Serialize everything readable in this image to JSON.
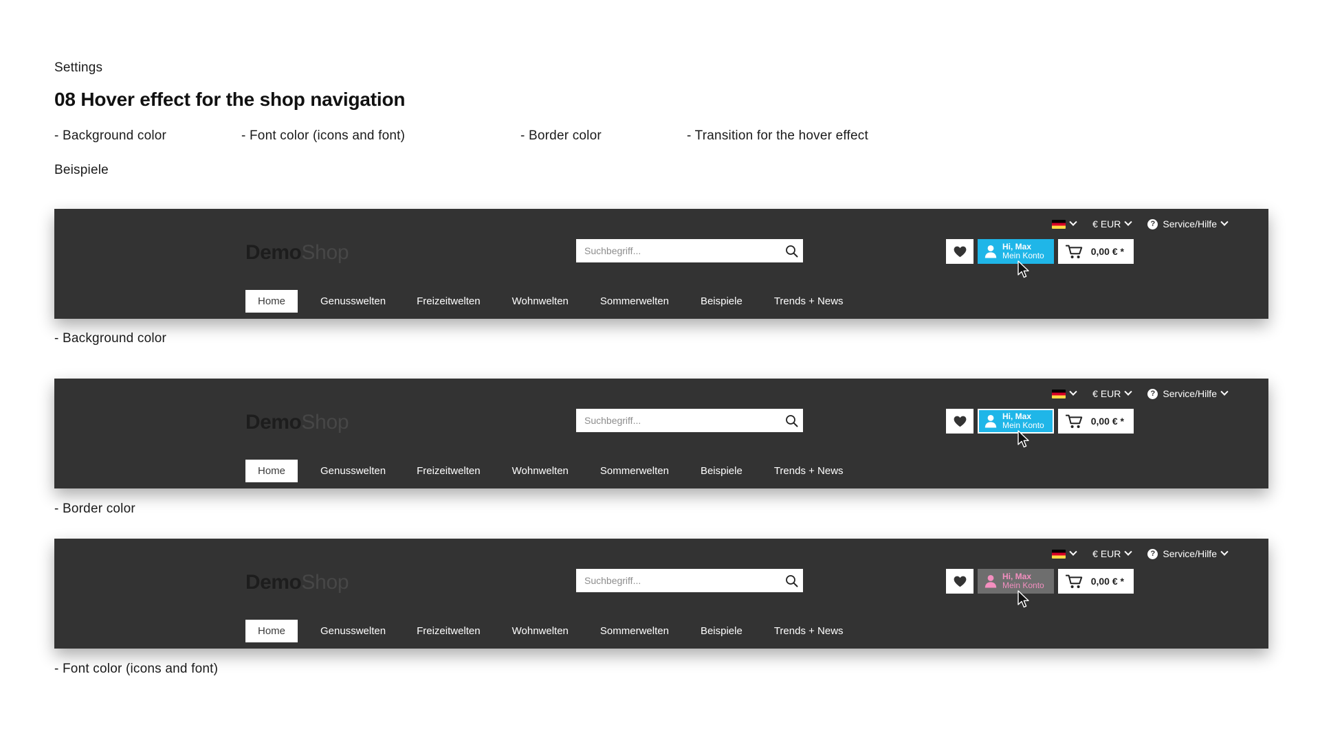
{
  "doc": {
    "eyebrow": "Settings",
    "title": "08 Hover effect for the shop navigation",
    "properties": [
      "- Background color",
      "- Font color (icons and font)",
      "- Border color",
      "- Transition for the hover effect"
    ],
    "examples_label": "Beispiele"
  },
  "colors": {
    "header_bg": "#333333",
    "accent_cyan": "#1fb6e8",
    "font_color_pink": "#f48fc0",
    "hover_gray": "#6e6e6e",
    "white": "#ffffff",
    "text_dark": "#1a1a1a"
  },
  "shop": {
    "utility": {
      "language": {
        "icon": "flag-de-icon",
        "label": ""
      },
      "currency": "€ EUR",
      "service": "Service/Hilfe"
    },
    "logo": {
      "bold": "Demo",
      "thin": "Shop"
    },
    "search": {
      "placeholder": "Suchbegriff...",
      "value": ""
    },
    "actions": {
      "wishlist_icon": "heart-icon",
      "account": {
        "greeting": "Hi, Max",
        "subtitle": "Mein Konto",
        "icon": "user-icon"
      },
      "cart": {
        "icon": "cart-icon",
        "amount": "0,00 € *"
      }
    },
    "nav": [
      {
        "label": "Home",
        "active": true
      },
      {
        "label": "Genusswelten",
        "active": false
      },
      {
        "label": "Freizeitwelten",
        "active": false
      },
      {
        "label": "Wohnwelten",
        "active": false
      },
      {
        "label": "Sommerwelten",
        "active": false
      },
      {
        "label": "Beispiele",
        "active": false
      },
      {
        "label": "Trends + News",
        "active": false
      }
    ]
  },
  "examples": [
    {
      "caption": "- Background color"
    },
    {
      "caption": "- Border color"
    },
    {
      "caption": "- Font color (icons and font)"
    }
  ]
}
